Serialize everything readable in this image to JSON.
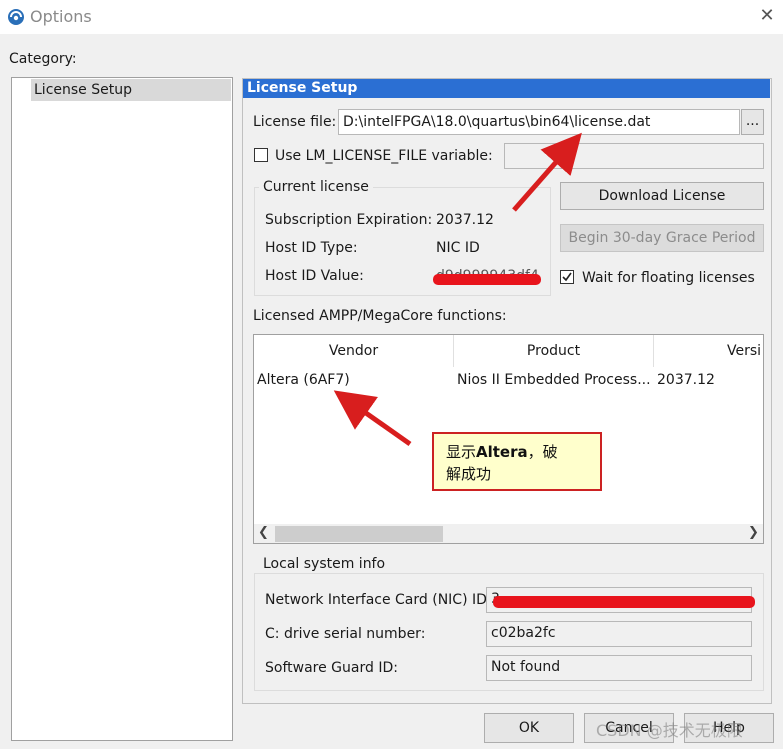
{
  "window": {
    "title": "Options"
  },
  "category": {
    "label": "Category:",
    "items": [
      {
        "label": "License Setup"
      }
    ]
  },
  "page": {
    "header": "License Setup",
    "license_file": {
      "label": "License file:",
      "value": "D:\\intelFPGA\\18.0\\quartus\\bin64\\license.dat",
      "browse": "..."
    },
    "lm_license": {
      "label": "Use LM_LICENSE_FILE variable:",
      "checked": false,
      "value": ""
    },
    "current_license": {
      "title": "Current license",
      "rows": [
        {
          "label": "Subscription Expiration:",
          "value": "2037.12"
        },
        {
          "label": "Host ID Type:",
          "value": "NIC ID"
        },
        {
          "label": "Host ID Value:",
          "value": "d9d999943df4"
        }
      ]
    },
    "buttons": {
      "download": "Download License",
      "grace": "Begin 30-day Grace Period"
    },
    "wait_floating": {
      "label": "Wait for floating licenses",
      "checked": true
    },
    "ampp": {
      "label": "Licensed AMPP/MegaCore functions:",
      "columns": [
        "Vendor",
        "Product",
        "Versi"
      ],
      "rows": [
        [
          "Altera (6AF7)",
          "Nios II Embedded Process...",
          "2037.12"
        ]
      ]
    },
    "local_info": {
      "title": "Local system info",
      "rows": [
        {
          "label": "Network Interface Card (NIC) ID:",
          "value": "3"
        },
        {
          "label": "C: drive serial number:",
          "value": "c02ba2fc"
        },
        {
          "label": "Software Guard ID:",
          "value": "Not found"
        }
      ]
    }
  },
  "footer": {
    "ok": "OK",
    "cancel": "Cancel",
    "help": "Help"
  },
  "annotation": {
    "callout_line1_prefix": "显示",
    "callout_bold": "Altera",
    "callout_line1_suffix": "，破",
    "callout_line2": "解成功"
  },
  "watermark": "CSDN @技术无极限",
  "colors": {
    "header": "#2b6fd3",
    "redact": "#e8141c",
    "arrow": "#d81e1e",
    "callout_bg": "#ffffcc"
  }
}
